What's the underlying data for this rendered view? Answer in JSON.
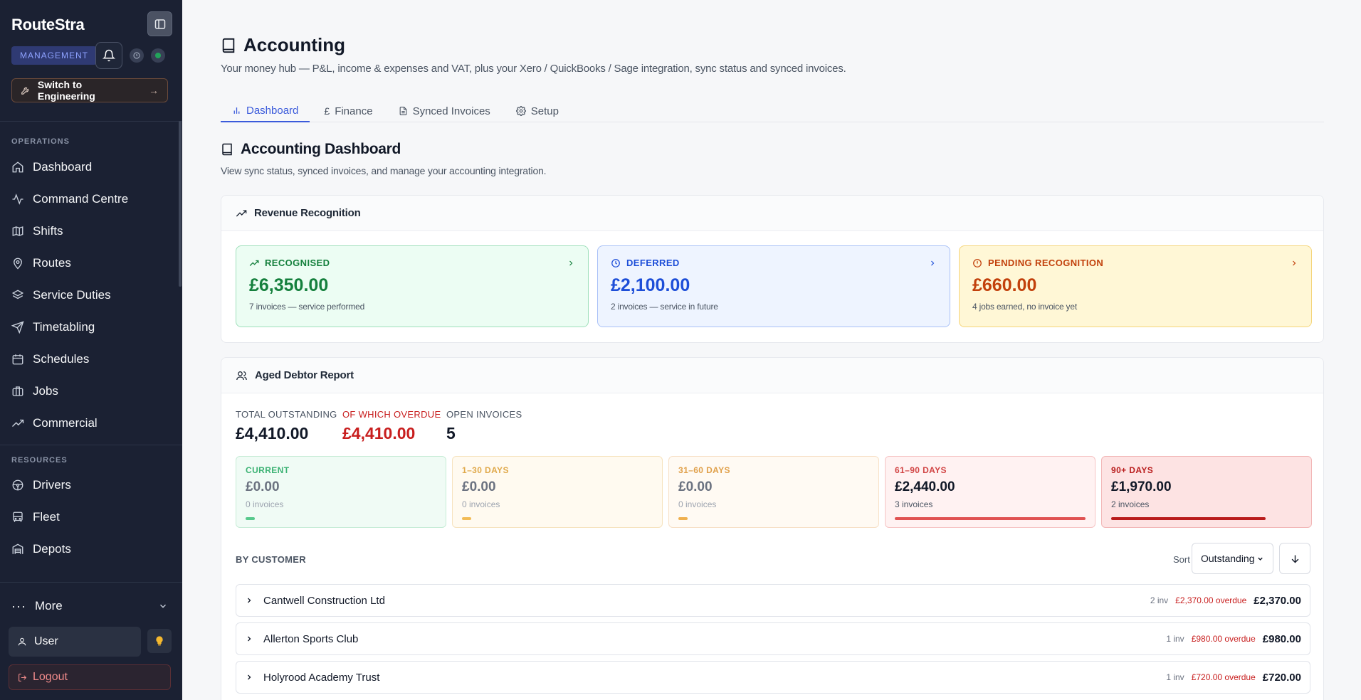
{
  "sidebar": {
    "brand": "RouteStra",
    "role_badge": "MANAGEMENT",
    "switch_label": "Switch to Engineering",
    "sections": [
      {
        "label": "OPERATIONS"
      },
      {
        "label": "RESOURCES"
      }
    ],
    "items": [
      {
        "label": "Dashboard",
        "icon": "home-icon"
      },
      {
        "label": "Command Centre",
        "icon": "activity-icon"
      },
      {
        "label": "Shifts",
        "icon": "map-icon"
      },
      {
        "label": "Routes",
        "icon": "map-pin-icon"
      },
      {
        "label": "Service Duties",
        "icon": "layers-icon"
      },
      {
        "label": "Timetabling",
        "icon": "send-icon"
      },
      {
        "label": "Schedules",
        "icon": "calendar-icon"
      },
      {
        "label": "Jobs",
        "icon": "briefcase-icon"
      },
      {
        "label": "Commercial",
        "icon": "trending-up-icon"
      },
      {
        "label": "Drivers",
        "icon": "steering-wheel-icon"
      },
      {
        "label": "Fleet",
        "icon": "bus-icon"
      },
      {
        "label": "Depots",
        "icon": "warehouse-icon"
      }
    ],
    "more_label": "More",
    "user_label": "User",
    "logout_label": "Logout"
  },
  "page": {
    "title": "Accounting",
    "subtitle": "Your money hub — P&L, income & expenses and VAT, plus your Xero / QuickBooks / Sage integration, sync status and synced invoices.",
    "tabs": [
      {
        "label": "Dashboard",
        "icon": "bar-chart-icon"
      },
      {
        "label": "Finance",
        "icon": "pound-icon"
      },
      {
        "label": "Synced Invoices",
        "icon": "file-icon"
      },
      {
        "label": "Setup",
        "icon": "gear-icon"
      }
    ],
    "active_tab": "Dashboard"
  },
  "dashboard": {
    "title": "Accounting Dashboard",
    "subtitle": "View sync status, synced invoices, and manage your accounting integration."
  },
  "revenue": {
    "title": "Revenue Recognition",
    "cards": [
      {
        "label": "RECOGNISED",
        "amount": "£6,350.00",
        "note": "7 invoices — service performed"
      },
      {
        "label": "DEFERRED",
        "amount": "£2,100.00",
        "note": "2 invoices — service in future"
      },
      {
        "label": "PENDING RECOGNITION",
        "amount": "£660.00",
        "note": "4 jobs earned, no invoice yet"
      }
    ]
  },
  "aged": {
    "title": "Aged Debtor Report",
    "totals": [
      {
        "label": "TOTAL OUTSTANDING",
        "value": "£4,410.00"
      },
      {
        "label": "OF WHICH OVERDUE",
        "value": "£4,410.00"
      },
      {
        "label": "OPEN INVOICES",
        "value": "5"
      }
    ],
    "buckets": [
      {
        "label": "CURRENT",
        "amount": "£0.00",
        "count": "0 invoices",
        "fill": 0.05
      },
      {
        "label": "1–30 DAYS",
        "amount": "£0.00",
        "count": "0 invoices",
        "fill": 0.05
      },
      {
        "label": "31–60 DAYS",
        "amount": "£0.00",
        "count": "0 invoices",
        "fill": 0.05
      },
      {
        "label": "61–90 DAYS",
        "amount": "£2,440.00",
        "count": "3 invoices",
        "fill": 1.0
      },
      {
        "label": "90+ DAYS",
        "amount": "£1,970.00",
        "count": "2 invoices",
        "fill": 0.81
      }
    ],
    "by_customer_label": "BY CUSTOMER",
    "sort_label": "Sort",
    "sort_value": "Outstanding",
    "customers": [
      {
        "name": "Cantwell Construction Ltd",
        "inv": "2 inv",
        "overdue": "£2,370.00 overdue",
        "total": "£2,370.00"
      },
      {
        "name": "Allerton Sports Club",
        "inv": "1 inv",
        "overdue": "£980.00 overdue",
        "total": "£980.00"
      },
      {
        "name": "Holyrood Academy Trust",
        "inv": "1 inv",
        "overdue": "£720.00 overdue",
        "total": "£720.00"
      }
    ]
  },
  "colors": {
    "accent": "#3b5bdb",
    "sidebar_bg": "#1b2133",
    "recognised": "#15803d",
    "deferred": "#1d4ed8",
    "pending": "#c2410c",
    "overdue": "#c81e1e"
  }
}
